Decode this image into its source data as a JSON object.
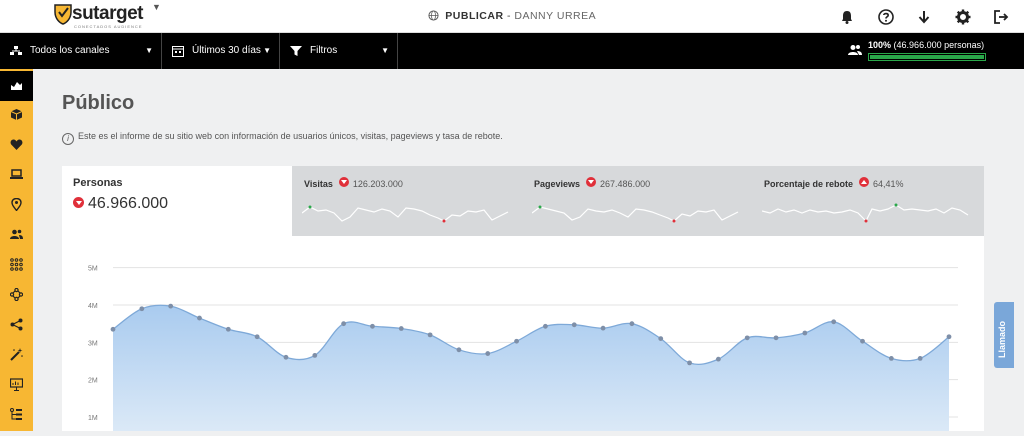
{
  "brand": {
    "name": "sutarget",
    "tagline": "CONECTADOS AUDIENCE"
  },
  "header": {
    "project": "PUBLICAR",
    "separator": " - ",
    "user": "DANNY URREA",
    "icons": [
      "bell-icon",
      "help-icon",
      "download-icon",
      "gear-icon",
      "logout-icon"
    ]
  },
  "filters": {
    "channels": "Todos los canales",
    "period": "Últimos 30 días",
    "filters": "Filtros"
  },
  "people": {
    "percent_label": "100%",
    "count_label": "(46.966.000 personas)",
    "progress": 1.0
  },
  "sidebar": {
    "items": [
      "dashboard-icon",
      "box-icon",
      "heart-icon",
      "laptop-icon",
      "location-icon",
      "users-icon",
      "grid-icon",
      "network-icon",
      "share-icon",
      "magic-wand-icon",
      "presentation-icon",
      "hierarchy-icon"
    ],
    "active_index": 0
  },
  "page": {
    "title": "Público",
    "info": "Este es el informe de su sitio web con información de usuarios únicos, visitas, pageviews y tasa de rebote."
  },
  "kpis": {
    "main": {
      "label": "Personas",
      "value": "46.966.000",
      "trend": "down"
    },
    "others": [
      {
        "label": "Visitas",
        "value": "126.203.000",
        "trend": "down"
      },
      {
        "label": "Pageviews",
        "value": "267.486.000",
        "trend": "down"
      },
      {
        "label": "Porcentaje de rebote",
        "value": "64,41%",
        "trend": "up"
      }
    ]
  },
  "side_tab": {
    "label": "Llamado"
  },
  "colors": {
    "accent": "#f7b733",
    "area_fill": "#b9d7f3",
    "line": "#7ea9d8",
    "progress": "#2aa84a",
    "down": "#e0303a"
  },
  "chart_data": {
    "type": "area",
    "ylabel": "",
    "xlabel": "",
    "y_ticks": [
      "1M",
      "2M",
      "3M",
      "4M",
      "5M"
    ],
    "ylim": [
      0,
      5
    ],
    "grid": true,
    "series": [
      {
        "values": [
          3.35,
          3.9,
          3.97,
          3.65,
          3.35,
          3.15,
          2.6,
          2.65,
          3.5,
          3.43,
          3.37,
          3.2,
          2.8,
          2.7,
          3.03,
          3.43,
          3.47,
          3.38,
          3.5,
          3.1,
          2.45,
          2.55,
          3.12,
          3.12,
          3.25,
          3.55,
          3.03,
          2.57,
          2.57,
          3.15
        ]
      }
    ]
  }
}
